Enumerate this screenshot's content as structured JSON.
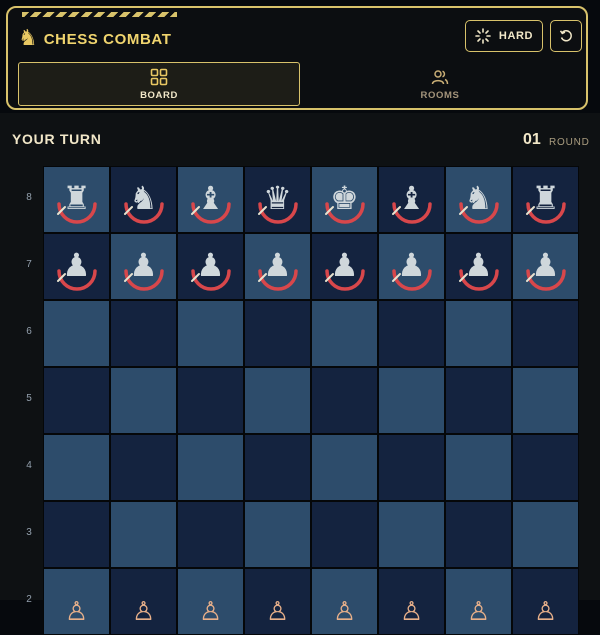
{
  "app": {
    "title": "CHESS COMBAT"
  },
  "header": {
    "difficulty_label": "HARD",
    "tabs": [
      {
        "label": "BOARD",
        "icon": "grid-icon",
        "active": true
      },
      {
        "label": "ROOMS",
        "icon": "users-icon",
        "active": false
      }
    ]
  },
  "status": {
    "turn": "YOUR TURN",
    "round": "01",
    "round_label": "ROUND"
  },
  "board": {
    "ranks": [
      "8",
      "7",
      "6",
      "5",
      "4",
      "3",
      "2"
    ],
    "rows": [
      [
        "♜",
        "♞",
        "♝",
        "♛",
        "♚",
        "♝",
        "♞",
        "♜"
      ],
      [
        "♟",
        "♟",
        "♟",
        "♟",
        "♟",
        "♟",
        "♟",
        "♟"
      ],
      [
        "",
        "",
        "",
        "",
        "",
        "",
        "",
        ""
      ],
      [
        "",
        "",
        "",
        "",
        "",
        "",
        "",
        ""
      ],
      [
        "",
        "",
        "",
        "",
        "",
        "",
        "",
        ""
      ],
      [
        "",
        "",
        "",
        "",
        "",
        "",
        "",
        ""
      ],
      [
        "♙",
        "♙",
        "♙",
        "♙",
        "♙",
        "♙",
        "♙",
        "♙"
      ]
    ]
  },
  "colors": {
    "accent": "#d8c26b",
    "light_square": "#2d4c6b",
    "dark_square": "#14233f",
    "ring": "#d8474b"
  }
}
